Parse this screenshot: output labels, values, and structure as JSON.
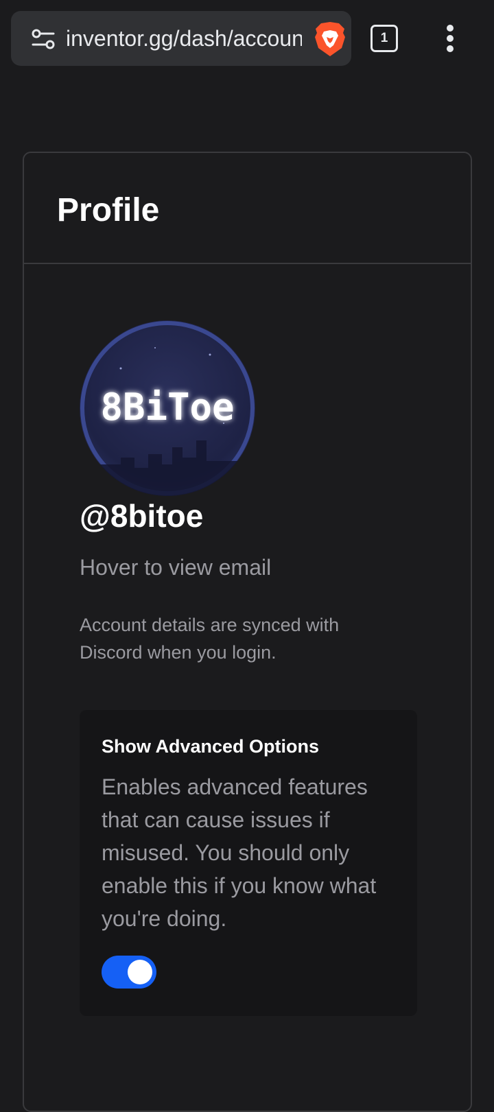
{
  "browser": {
    "url": "inventor.gg/dash/account",
    "tab_count": "1",
    "colors": {
      "toolbar": "#1b1b1d",
      "omnibox": "#303134",
      "brave_orange": "#fb542b"
    }
  },
  "profile": {
    "title": "Profile",
    "avatar_text": "8BiToe",
    "username": "@8bitoe",
    "email_hint": "Hover to view email",
    "sync_note": "Account details are synced with Discord when you login."
  },
  "advanced_options": {
    "title": "Show Advanced Options",
    "description": "Enables advanced features that can cause issues if misused. You should only enable this if you know what you're doing.",
    "enabled": true,
    "toggle_color": "#1560f5"
  }
}
